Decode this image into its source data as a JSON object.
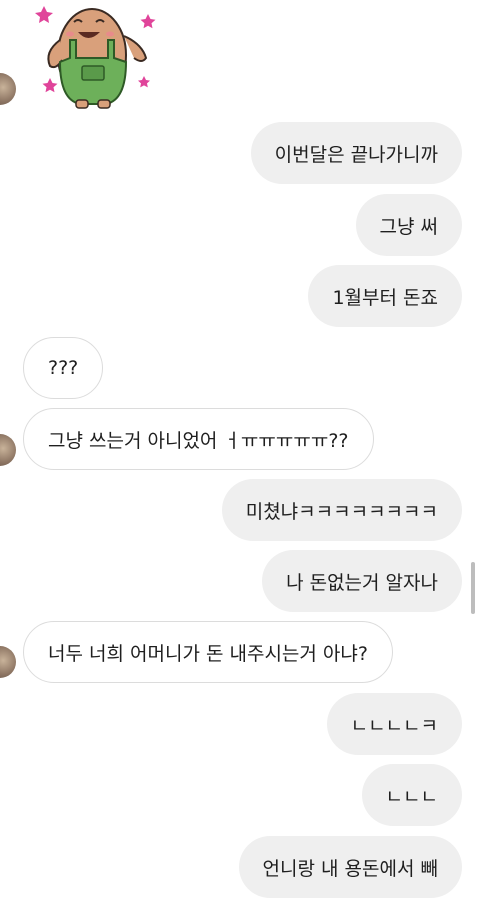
{
  "sticker": {
    "name": "potato-character-sticker"
  },
  "messages": [
    {
      "side": "out",
      "text": "이번달은 끝나가니까"
    },
    {
      "side": "out",
      "text": "그냥 써"
    },
    {
      "side": "out",
      "text": "1월부터 돈죠"
    },
    {
      "side": "in",
      "text": "???"
    },
    {
      "side": "in",
      "text": "그냥 쓰는거 아니었어 ㅓㅠㅠㅠㅠㅠ??"
    },
    {
      "side": "out",
      "text": "미쳤냐ㅋㅋㅋㅋㅋㅋㅋㅋ"
    },
    {
      "side": "out",
      "text": "나 돈없는거 알자나"
    },
    {
      "side": "in",
      "text": "너두 너희 어머니가 돈 내주시는거 아냐?"
    },
    {
      "side": "out",
      "text": "ㄴㄴㄴㄴㅋ"
    },
    {
      "side": "out",
      "text": "ㄴㄴㄴ"
    },
    {
      "side": "out",
      "text": "언니랑 내 용돈에서 빼"
    }
  ],
  "colors": {
    "outgoing_bubble": "#efefef",
    "incoming_border": "#dcdcdc",
    "text": "#1f1f1f"
  }
}
